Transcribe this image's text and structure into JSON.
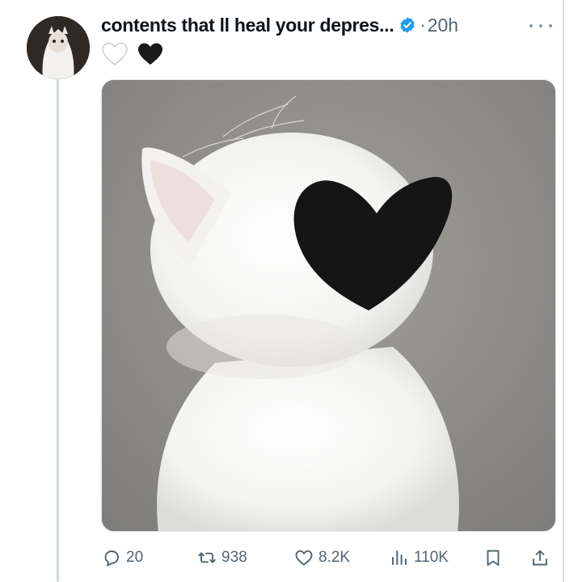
{
  "post": {
    "author_display_name": "contents that ll heal your depres...",
    "separator": "·",
    "timestamp": "20h",
    "emojis": [
      "white-heart",
      "black-heart"
    ],
    "image_alt": "white cat with black heart-shaped ear"
  },
  "actions": {
    "replies": "20",
    "reposts": "938",
    "likes": "8.2K",
    "views": "110K"
  },
  "colors": {
    "verified_badge": "#1d9bf0",
    "secondary_text": "#536471",
    "thread_line": "#cfd9de"
  }
}
